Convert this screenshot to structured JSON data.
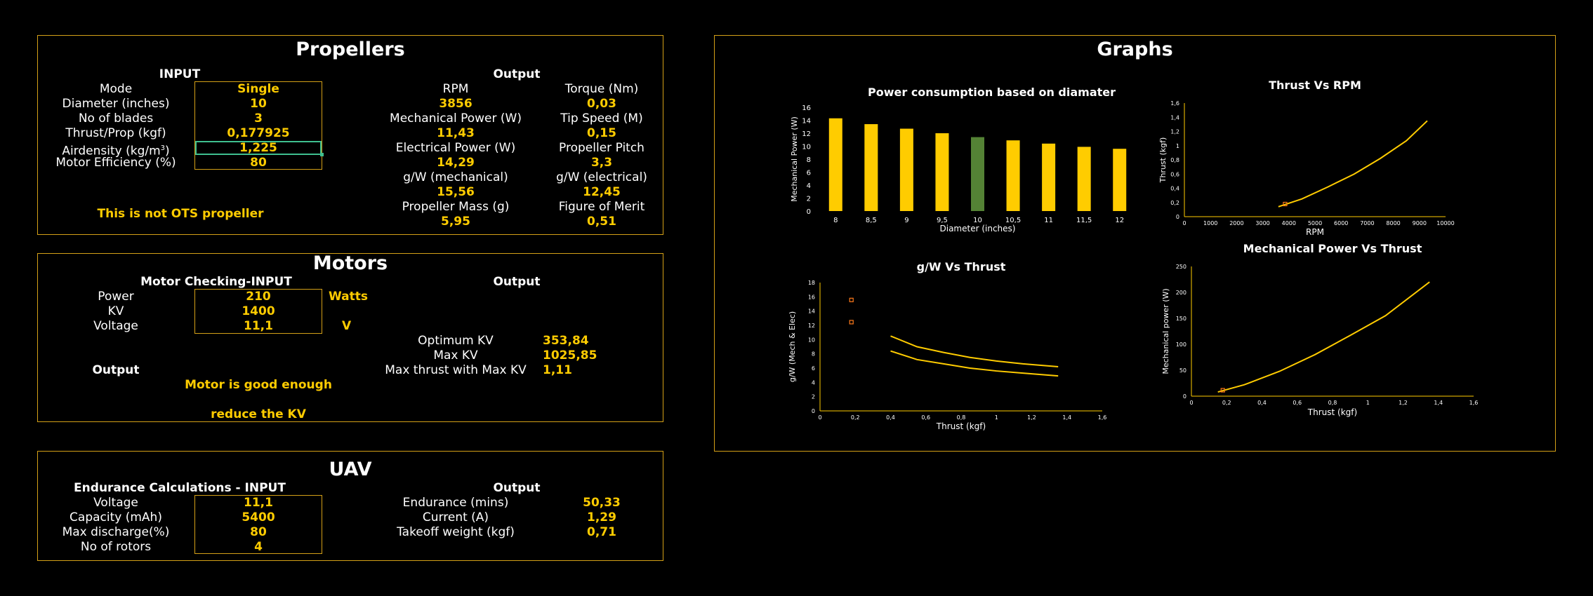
{
  "propellers": {
    "title": "Propellers",
    "input_header": "INPUT",
    "output_header": "Output",
    "inputs": [
      {
        "label": "Mode",
        "value": "Single"
      },
      {
        "label": "Diameter (inches)",
        "value": "10"
      },
      {
        "label": "No of blades",
        "value": "3"
      },
      {
        "label": "Thrust/Prop (kgf)",
        "value": "0,177925"
      },
      {
        "label": "Airdensity (kg/m",
        "label_sup": "3",
        "label_end": ")",
        "value": "1,225"
      },
      {
        "label": "Motor Efficiency (%)",
        "value": "80"
      }
    ],
    "warning": "This is not OTS propeller",
    "outputs_left": [
      {
        "label": "RPM",
        "value": "3856"
      },
      {
        "label": "Mechanical Power (W)",
        "value": "11,43"
      },
      {
        "label": "Electrical Power (W)",
        "value": "14,29"
      },
      {
        "label": "g/W (mechanical)",
        "value": "15,56"
      },
      {
        "label": "Propeller Mass (g)",
        "value": "5,95"
      }
    ],
    "outputs_right": [
      {
        "label": "Torque (Nm)",
        "value": "0,03"
      },
      {
        "label": "Tip Speed (M)",
        "value": "0,15"
      },
      {
        "label": "Propeller Pitch",
        "value": "3,3"
      },
      {
        "label": "g/W (electrical)",
        "value": "12,45"
      },
      {
        "label": "Figure of Merit",
        "value": "0,51"
      }
    ]
  },
  "motors": {
    "title": "Motors",
    "input_header": "Motor Checking-INPUT",
    "output_header": "Output",
    "inputs": [
      {
        "label": "Power",
        "value": "210",
        "unit": "Watts"
      },
      {
        "label": "KV",
        "value": "1400",
        "unit": ""
      },
      {
        "label": "Voltage",
        "value": "11,1",
        "unit": "V"
      }
    ],
    "output_label": "Output",
    "status": "Motor is good enough",
    "advice": "reduce the KV",
    "outputs": [
      {
        "label": "Optimum KV",
        "value": "353,84"
      },
      {
        "label": "Max KV",
        "value": "1025,85"
      },
      {
        "label": "Max thrust with Max KV",
        "value": "1,11"
      }
    ]
  },
  "uav": {
    "title": "UAV",
    "input_header": "Endurance Calculations - INPUT",
    "output_header": "Output",
    "inputs": [
      {
        "label": "Voltage",
        "value": "11,1"
      },
      {
        "label": "Capacity (mAh)",
        "value": "5400"
      },
      {
        "label": "Max discharge(%)",
        "value": "80"
      },
      {
        "label": "No of rotors",
        "value": "4"
      }
    ],
    "outputs": [
      {
        "label": "Endurance (mins)",
        "value": "50,33"
      },
      {
        "label": "Current (A)",
        "value": "1,29"
      },
      {
        "label": "Takeoff weight (kgf)",
        "value": "0,71"
      }
    ]
  },
  "graphs": {
    "title": "Graphs"
  },
  "colors": {
    "accent": "#ffcc00",
    "border": "#d4a017",
    "highlight_bar": "#548235",
    "selection": "#3fbf8f"
  },
  "chart_data": [
    {
      "id": "power_vs_diameter",
      "type": "bar",
      "title": "Power consumption based on diamater",
      "xlabel": "Diameter (inches)",
      "ylabel": "Mechanical Power (W)",
      "categories": [
        "8",
        "8,5",
        "9",
        "9,5",
        "10",
        "10,5",
        "11",
        "11,5",
        "12"
      ],
      "values": [
        14.3,
        13.4,
        12.7,
        12.0,
        11.4,
        10.9,
        10.4,
        9.9,
        9.6
      ],
      "highlight_index": 4,
      "ylim": [
        0,
        16
      ],
      "yticks": [
        "0",
        "2",
        "4",
        "6",
        "8",
        "10",
        "12",
        "14",
        "16"
      ],
      "grid": false
    },
    {
      "id": "thrust_vs_rpm",
      "type": "line",
      "title": "Thrust Vs RPM",
      "xlabel": "RPM",
      "ylabel": "Thrust (kgf)",
      "xlim": [
        0,
        10000
      ],
      "ylim": [
        0,
        1.6
      ],
      "xticks": [
        "0",
        "1000",
        "2000",
        "3000",
        "4000",
        "5000",
        "6000",
        "7000",
        "8000",
        "9000",
        "10000"
      ],
      "yticks": [
        "0",
        "0,2",
        "0,4",
        "0,6",
        "0,8",
        "1",
        "1,2",
        "1,4",
        "1,6"
      ],
      "series": [
        {
          "x": [
            3600,
            4500,
            5500,
            6500,
            7500,
            8500,
            9300
          ],
          "y": [
            0.14,
            0.25,
            0.42,
            0.6,
            0.82,
            1.07,
            1.35
          ]
        }
      ],
      "marker": {
        "x": 3856,
        "y": 0.178
      },
      "grid": false
    },
    {
      "id": "gw_vs_thrust",
      "type": "line",
      "title": "g/W Vs Thrust",
      "xlabel": "Thrust (kgf)",
      "ylabel": "g/W (Mech & Elec)",
      "xlim": [
        0,
        1.6
      ],
      "ylim": [
        0,
        18
      ],
      "xticks": [
        "0",
        "0,2",
        "0,4",
        "0,6",
        "0,8",
        "1",
        "1,2",
        "1,4",
        "1,6"
      ],
      "yticks": [
        "0",
        "2",
        "4",
        "6",
        "8",
        "10",
        "12",
        "14",
        "16",
        "18"
      ],
      "series": [
        {
          "x": [
            0.4,
            0.55,
            0.7,
            0.85,
            1.0,
            1.15,
            1.35
          ],
          "y": [
            10.5,
            9.0,
            8.2,
            7.5,
            7.0,
            6.6,
            6.2
          ]
        },
        {
          "x": [
            0.4,
            0.55,
            0.7,
            0.85,
            1.0,
            1.15,
            1.35
          ],
          "y": [
            8.4,
            7.2,
            6.6,
            6.0,
            5.6,
            5.3,
            4.9
          ]
        }
      ],
      "markers": [
        {
          "x": 0.178,
          "y": 15.56
        },
        {
          "x": 0.178,
          "y": 12.45
        }
      ],
      "grid": false
    },
    {
      "id": "power_vs_thrust",
      "type": "line",
      "title": "Mechanical Power Vs Thrust",
      "xlabel": "Thrust (kgf)",
      "ylabel": "Mechanical power (W)",
      "xlim": [
        0,
        1.6
      ],
      "ylim": [
        0,
        250
      ],
      "xticks": [
        "0",
        "0,2",
        "0,4",
        "0,6",
        "0,8",
        "1",
        "1,2",
        "1,4",
        "1,6"
      ],
      "yticks": [
        "0",
        "50",
        "100",
        "150",
        "200",
        "250"
      ],
      "series": [
        {
          "x": [
            0.15,
            0.3,
            0.5,
            0.7,
            0.9,
            1.1,
            1.35
          ],
          "y": [
            8,
            22,
            48,
            80,
            117,
            155,
            220
          ]
        }
      ],
      "marker": {
        "x": 0.178,
        "y": 11.43
      },
      "grid": false
    }
  ]
}
